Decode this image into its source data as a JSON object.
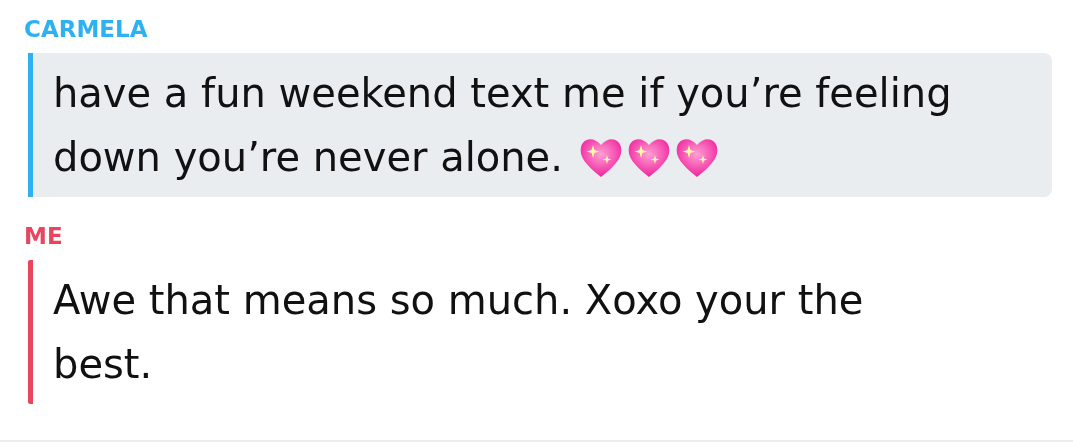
{
  "messages": [
    {
      "sender": "CARMELA",
      "color": "#2fb0f0",
      "highlighted": true,
      "lines": [
        "have a fun weekend text me if you’re feeling",
        "down you’re never alone."
      ],
      "emoji": [
        {
          "kind": "sparkling-heart"
        },
        {
          "kind": "sparkling-heart"
        },
        {
          "kind": "sparkling-heart"
        }
      ]
    },
    {
      "sender": "ME",
      "color": "#e8455f",
      "highlighted": false,
      "lines": [
        "Awe that means so much. Xoxo your the",
        "best."
      ]
    }
  ]
}
